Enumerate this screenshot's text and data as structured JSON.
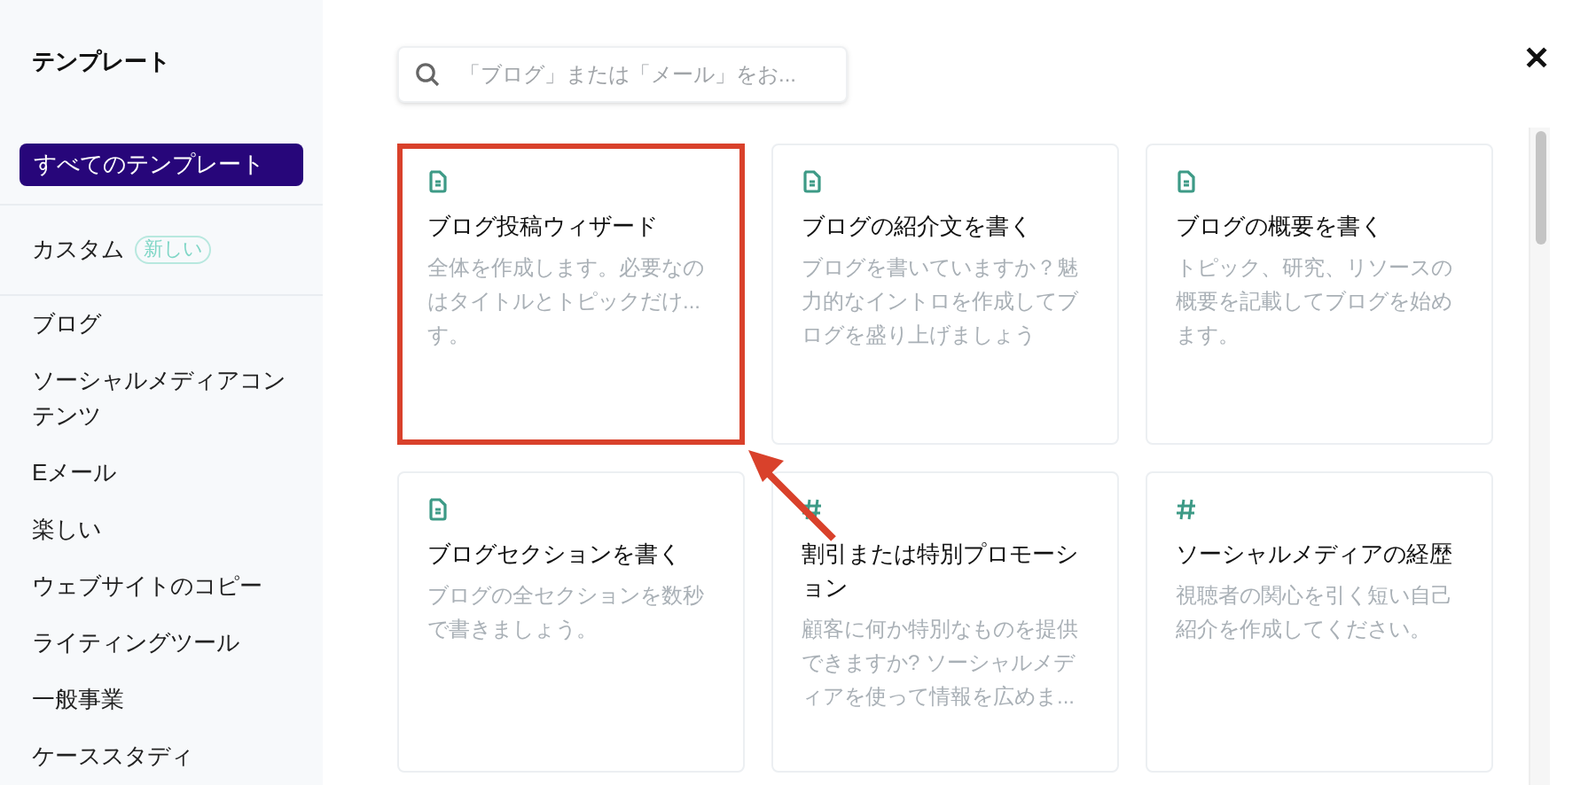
{
  "sidebar": {
    "title": "テンプレート",
    "items": [
      {
        "label": "すべてのテンプレート",
        "selected": true
      },
      {
        "label": "カスタム",
        "badge": "新しい",
        "selected": false
      },
      {
        "label": "ブログ",
        "selected": false
      },
      {
        "label": "ソーシャルメディアコンテンツ",
        "selected": false
      },
      {
        "label": "Eメール",
        "selected": false
      },
      {
        "label": "楽しい",
        "selected": false
      },
      {
        "label": "ウェブサイトのコピー",
        "selected": false
      },
      {
        "label": "ライティングツール",
        "selected": false
      },
      {
        "label": "一般事業",
        "selected": false
      },
      {
        "label": "ケーススタディ",
        "selected": false
      }
    ]
  },
  "search": {
    "placeholder": "「ブログ」または「メール」をお..."
  },
  "close": {
    "label": "✕"
  },
  "cards": [
    {
      "kind": "doc",
      "title": "ブログ投稿ウィザード",
      "description": "全体を作成します。必要なのはタイトルとトピックだけ...す。",
      "highlighted": true
    },
    {
      "kind": "doc",
      "title": "ブログの紹介文を書く",
      "description": "ブログを書いていますか？魅力的なイントロを作成してブログを盛り上げましょう",
      "highlighted": false
    },
    {
      "kind": "doc",
      "title": "ブログの概要を書く",
      "description": "トピック、研究、リソースの概要を記載してブログを始めます。",
      "highlighted": false
    },
    {
      "kind": "doc",
      "title": "ブログセクションを書く",
      "description": "ブログの全セクションを数秒で書きましょう。",
      "highlighted": false
    },
    {
      "kind": "hash",
      "title": "割引または特別プロモーション",
      "description": "顧客に何か特別なものを提供できますか? ソーシャルメディアを使って情報を広めま...",
      "highlighted": false
    },
    {
      "kind": "hash",
      "title": "ソーシャルメディアの経歴",
      "description": "視聴者の関心を引く短い自己紹介を作成してください。",
      "highlighted": false
    }
  ]
}
